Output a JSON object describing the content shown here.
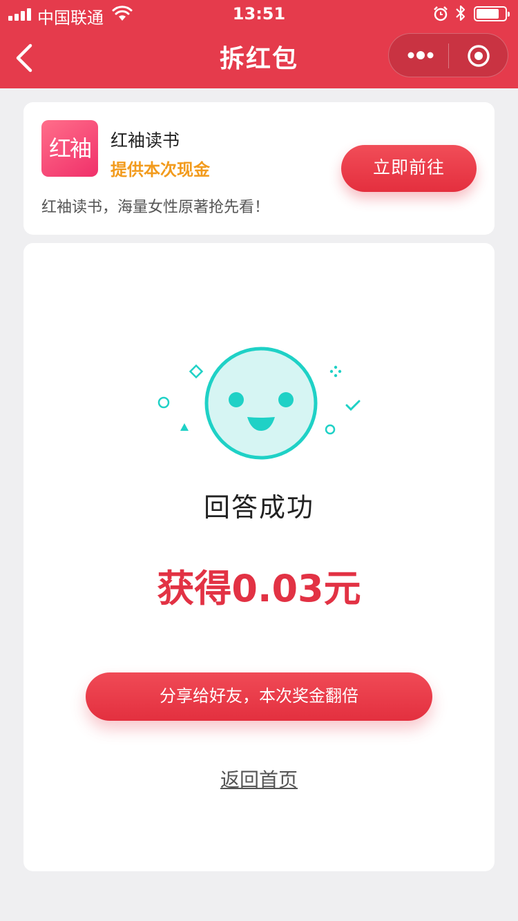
{
  "status_bar": {
    "carrier": "中国联通",
    "time": "13:51",
    "battery_level": 0.8
  },
  "nav": {
    "title": "拆红包"
  },
  "sponsor": {
    "logo_text": "红袖",
    "name": "红袖读书",
    "subtitle": "提供本次现金",
    "description": "红袖读书，海量女性原著抢先看！",
    "action_label": "立即前往"
  },
  "result": {
    "title": "回答成功",
    "reward": "获得0.03元",
    "share_label": "分享给好友，本次奖金翻倍",
    "home_label": "返回首页"
  },
  "colors": {
    "brand_red": "#e53b4c",
    "accent_orange": "#f29b1d",
    "smiley_teal": "#1fd1c6"
  }
}
